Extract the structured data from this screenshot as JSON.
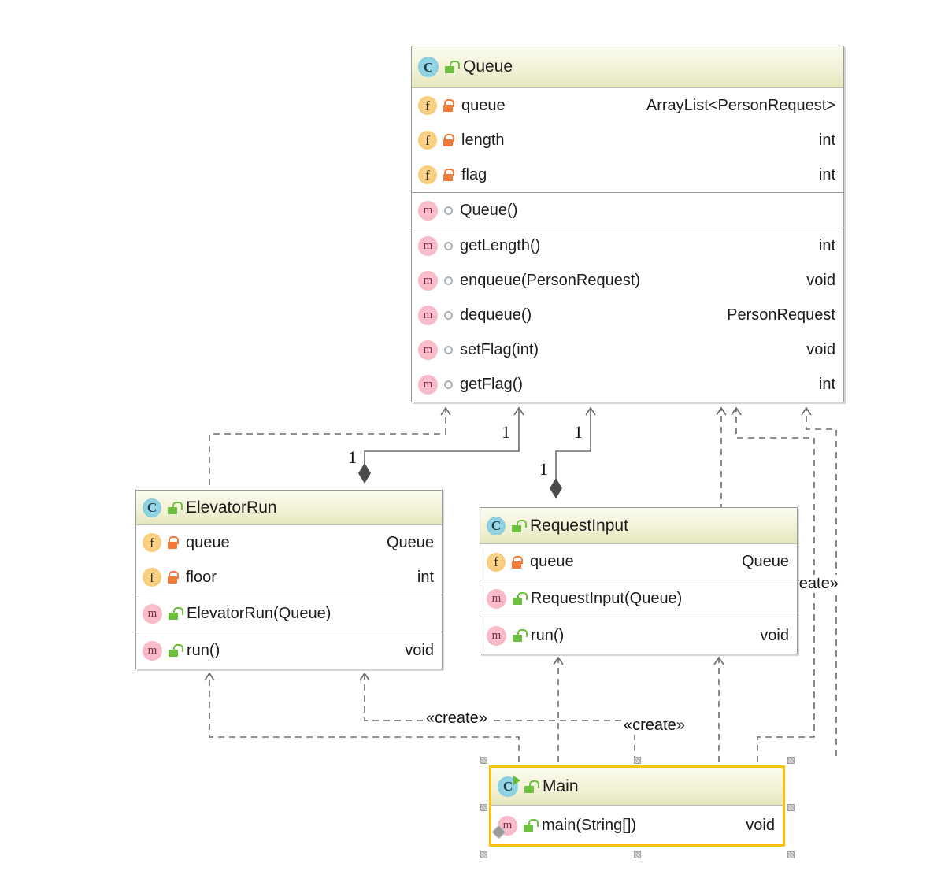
{
  "diagram": {
    "kind": "uml-class-diagram",
    "colors": {
      "selection": "#FFC107",
      "class_icon": "#8ed2e2",
      "field_icon": "#f8cd7c",
      "method_icon": "#fab9c9",
      "lock_private": "#f07a3a",
      "lock_public": "#6cbf3f",
      "connector": "#6b6b6b",
      "header_gradient_top": "#fbfbef",
      "header_gradient_bottom": "#e6e6bd"
    }
  },
  "classes": [
    {
      "id": "queue",
      "name": "Queue",
      "icon": "class-icon",
      "visibility_icon": "unlock-icon",
      "selected": false,
      "fields": [
        {
          "icon": "field-icon",
          "visibility_icon": "lock-icon",
          "name": "queue",
          "type": "ArrayList<PersonRequest>"
        },
        {
          "icon": "field-icon",
          "visibility_icon": "lock-icon",
          "name": "length",
          "type": "int"
        },
        {
          "icon": "field-icon",
          "visibility_icon": "lock-icon",
          "name": "flag",
          "type": "int"
        }
      ],
      "constructors": [
        {
          "icon": "method-icon",
          "visibility_icon": "package-dot-icon",
          "name": "Queue()",
          "type": ""
        }
      ],
      "methods": [
        {
          "icon": "method-icon",
          "visibility_icon": "package-dot-icon",
          "name": "getLength()",
          "type": "int"
        },
        {
          "icon": "method-icon",
          "visibility_icon": "package-dot-icon",
          "name": "enqueue(PersonRequest)",
          "type": "void"
        },
        {
          "icon": "method-icon",
          "visibility_icon": "package-dot-icon",
          "name": "dequeue()",
          "type": "PersonRequest"
        },
        {
          "icon": "method-icon",
          "visibility_icon": "package-dot-icon",
          "name": "setFlag(int)",
          "type": "void"
        },
        {
          "icon": "method-icon",
          "visibility_icon": "package-dot-icon",
          "name": "getFlag()",
          "type": "int"
        }
      ]
    },
    {
      "id": "elevatorrun",
      "name": "ElevatorRun",
      "icon": "class-icon",
      "visibility_icon": "unlock-icon",
      "selected": false,
      "fields": [
        {
          "icon": "field-icon",
          "visibility_icon": "lock-icon",
          "name": "queue",
          "type": "Queue"
        },
        {
          "icon": "field-icon",
          "visibility_icon": "lock-icon",
          "name": "floor",
          "type": "int"
        }
      ],
      "constructors": [
        {
          "icon": "method-icon",
          "visibility_icon": "unlock-icon",
          "name": "ElevatorRun(Queue)",
          "type": ""
        }
      ],
      "methods": [
        {
          "icon": "method-icon",
          "visibility_icon": "unlock-icon",
          "name": "run()",
          "type": "void"
        }
      ]
    },
    {
      "id": "requestinput",
      "name": "RequestInput",
      "icon": "class-icon",
      "visibility_icon": "unlock-icon",
      "selected": false,
      "fields": [
        {
          "icon": "field-icon",
          "visibility_icon": "lock-icon",
          "name": "queue",
          "type": "Queue"
        }
      ],
      "constructors": [
        {
          "icon": "method-icon",
          "visibility_icon": "unlock-icon",
          "name": "RequestInput(Queue)",
          "type": ""
        }
      ],
      "methods": [
        {
          "icon": "method-icon",
          "visibility_icon": "unlock-icon",
          "name": "run()",
          "type": "void"
        }
      ]
    },
    {
      "id": "main",
      "name": "Main",
      "icon": "class-icon-runnable",
      "visibility_icon": "unlock-icon",
      "selected": true,
      "fields": [],
      "constructors": [],
      "methods": [
        {
          "icon": "method-icon-override",
          "visibility_icon": "unlock-icon",
          "name": "main(String[])",
          "type": "void"
        }
      ]
    }
  ],
  "edge_labels": {
    "multiplicity_queue_left": "1",
    "multiplicity_queue_mid": "1",
    "multiplicity_elevatorrun": "1",
    "multiplicity_requestinput": "1",
    "create_right": "«create»",
    "create_left": "«create»",
    "create_mid": "«create»"
  }
}
